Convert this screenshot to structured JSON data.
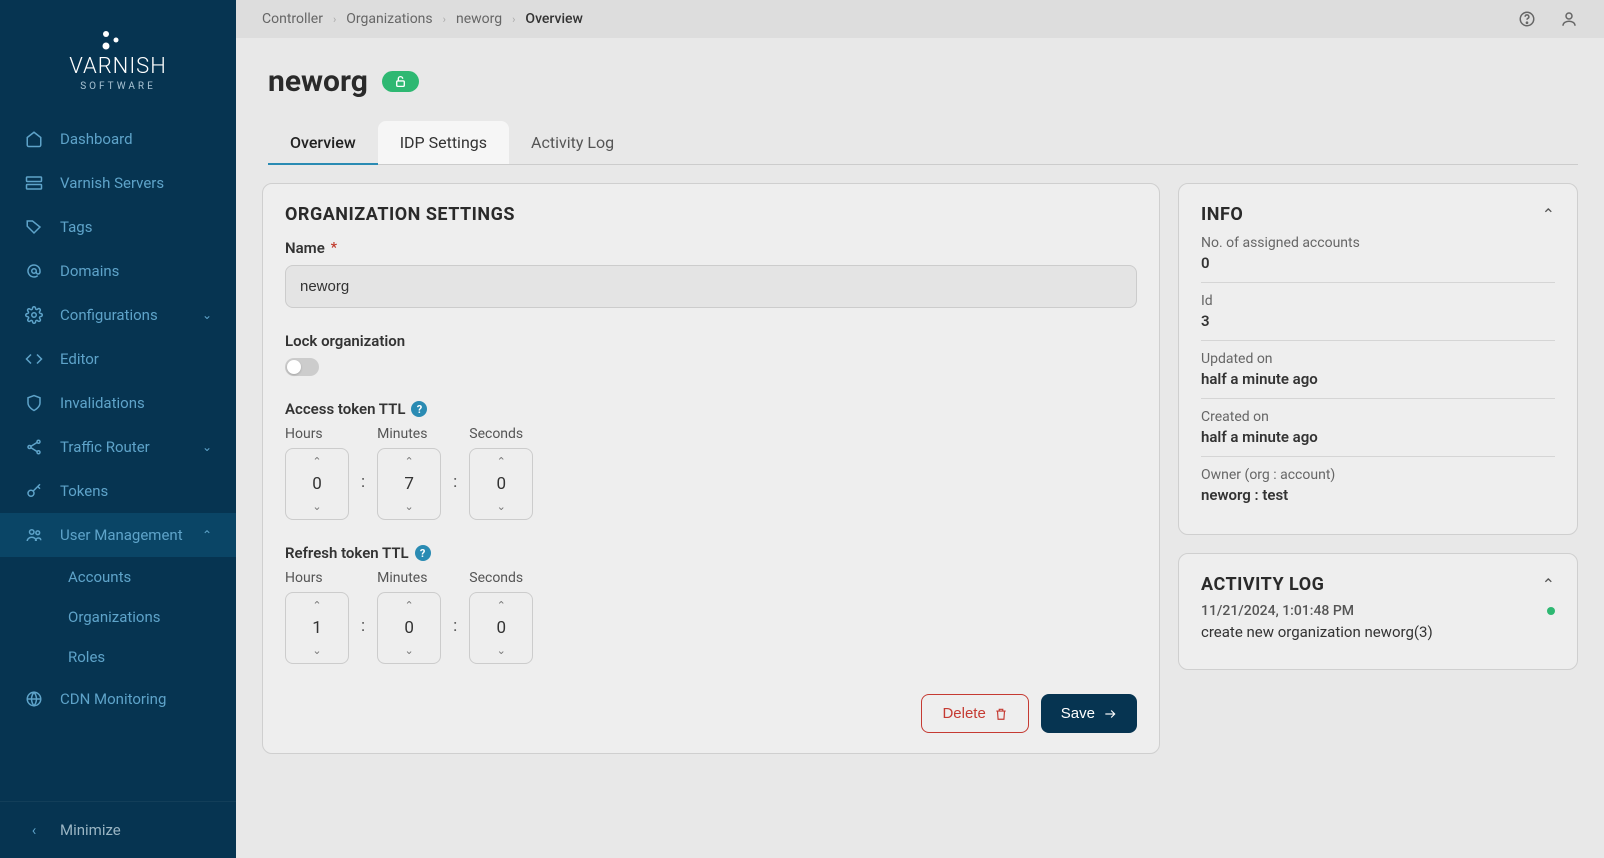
{
  "logo": {
    "main": "VARNISH",
    "sub": "SOFTWARE"
  },
  "sidebar": {
    "items": [
      {
        "label": "Dashboard"
      },
      {
        "label": "Varnish Servers"
      },
      {
        "label": "Tags"
      },
      {
        "label": "Domains"
      },
      {
        "label": "Configurations"
      },
      {
        "label": "Editor"
      },
      {
        "label": "Invalidations"
      },
      {
        "label": "Traffic Router"
      },
      {
        "label": "Tokens"
      },
      {
        "label": "User Management"
      },
      {
        "label": "CDN Monitoring"
      }
    ],
    "user_mgmt_sub": [
      {
        "label": "Accounts"
      },
      {
        "label": "Organizations"
      },
      {
        "label": "Roles"
      }
    ],
    "minimize": "Minimize"
  },
  "breadcrumbs": [
    "Controller",
    "Organizations",
    "neworg",
    "Overview"
  ],
  "page": {
    "title": "neworg"
  },
  "tabs": [
    "Overview",
    "IDP Settings",
    "Activity Log"
  ],
  "settings": {
    "panel_title": "ORGANIZATION SETTINGS",
    "name_label": "Name",
    "name_value": "neworg",
    "lock_label": "Lock organization",
    "lock_on": false,
    "access_ttl_label": "Access token TTL",
    "refresh_ttl_label": "Refresh token TTL",
    "ttl_sub": {
      "hours": "Hours",
      "minutes": "Minutes",
      "seconds": "Seconds"
    },
    "access_ttl": {
      "h": "0",
      "m": "7",
      "s": "0"
    },
    "refresh_ttl": {
      "h": "1",
      "m": "0",
      "s": "0"
    },
    "delete_label": "Delete",
    "save_label": "Save"
  },
  "info": {
    "title": "INFO",
    "rows": [
      {
        "key": "No. of assigned accounts",
        "val": "0"
      },
      {
        "key": "Id",
        "val": "3"
      },
      {
        "key": "Updated on",
        "val": "half a minute ago"
      },
      {
        "key": "Created on",
        "val": "half a minute ago"
      },
      {
        "key": "Owner (org : account)",
        "val": "neworg : test"
      }
    ]
  },
  "activity": {
    "title": "ACTIVITY LOG",
    "entries": [
      {
        "time": "11/21/2024, 1:01:48 PM",
        "msg": "create new organization neworg(3)"
      }
    ]
  }
}
